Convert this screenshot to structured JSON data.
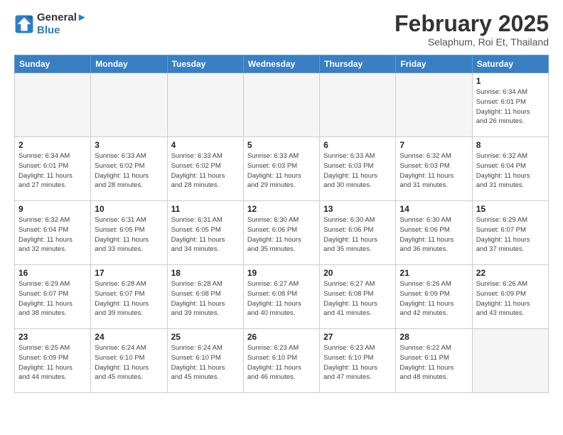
{
  "header": {
    "logo_line1": "General",
    "logo_line2": "Blue",
    "month": "February 2025",
    "location": "Selaphum, Roi Et, Thailand"
  },
  "weekdays": [
    "Sunday",
    "Monday",
    "Tuesday",
    "Wednesday",
    "Thursday",
    "Friday",
    "Saturday"
  ],
  "weeks": [
    [
      {
        "day": "",
        "info": ""
      },
      {
        "day": "",
        "info": ""
      },
      {
        "day": "",
        "info": ""
      },
      {
        "day": "",
        "info": ""
      },
      {
        "day": "",
        "info": ""
      },
      {
        "day": "",
        "info": ""
      },
      {
        "day": "1",
        "info": "Sunrise: 6:34 AM\nSunset: 6:01 PM\nDaylight: 11 hours\nand 26 minutes."
      }
    ],
    [
      {
        "day": "2",
        "info": "Sunrise: 6:34 AM\nSunset: 6:01 PM\nDaylight: 11 hours\nand 27 minutes."
      },
      {
        "day": "3",
        "info": "Sunrise: 6:33 AM\nSunset: 6:02 PM\nDaylight: 11 hours\nand 28 minutes."
      },
      {
        "day": "4",
        "info": "Sunrise: 6:33 AM\nSunset: 6:02 PM\nDaylight: 11 hours\nand 28 minutes."
      },
      {
        "day": "5",
        "info": "Sunrise: 6:33 AM\nSunset: 6:03 PM\nDaylight: 11 hours\nand 29 minutes."
      },
      {
        "day": "6",
        "info": "Sunrise: 6:33 AM\nSunset: 6:03 PM\nDaylight: 11 hours\nand 30 minutes."
      },
      {
        "day": "7",
        "info": "Sunrise: 6:32 AM\nSunset: 6:03 PM\nDaylight: 11 hours\nand 31 minutes."
      },
      {
        "day": "8",
        "info": "Sunrise: 6:32 AM\nSunset: 6:04 PM\nDaylight: 11 hours\nand 31 minutes."
      }
    ],
    [
      {
        "day": "9",
        "info": "Sunrise: 6:32 AM\nSunset: 6:04 PM\nDaylight: 11 hours\nand 32 minutes."
      },
      {
        "day": "10",
        "info": "Sunrise: 6:31 AM\nSunset: 6:05 PM\nDaylight: 11 hours\nand 33 minutes."
      },
      {
        "day": "11",
        "info": "Sunrise: 6:31 AM\nSunset: 6:05 PM\nDaylight: 11 hours\nand 34 minutes."
      },
      {
        "day": "12",
        "info": "Sunrise: 6:30 AM\nSunset: 6:06 PM\nDaylight: 11 hours\nand 35 minutes."
      },
      {
        "day": "13",
        "info": "Sunrise: 6:30 AM\nSunset: 6:06 PM\nDaylight: 11 hours\nand 35 minutes."
      },
      {
        "day": "14",
        "info": "Sunrise: 6:30 AM\nSunset: 6:06 PM\nDaylight: 11 hours\nand 36 minutes."
      },
      {
        "day": "15",
        "info": "Sunrise: 6:29 AM\nSunset: 6:07 PM\nDaylight: 11 hours\nand 37 minutes."
      }
    ],
    [
      {
        "day": "16",
        "info": "Sunrise: 6:29 AM\nSunset: 6:07 PM\nDaylight: 11 hours\nand 38 minutes."
      },
      {
        "day": "17",
        "info": "Sunrise: 6:28 AM\nSunset: 6:07 PM\nDaylight: 11 hours\nand 39 minutes."
      },
      {
        "day": "18",
        "info": "Sunrise: 6:28 AM\nSunset: 6:08 PM\nDaylight: 11 hours\nand 39 minutes."
      },
      {
        "day": "19",
        "info": "Sunrise: 6:27 AM\nSunset: 6:08 PM\nDaylight: 11 hours\nand 40 minutes."
      },
      {
        "day": "20",
        "info": "Sunrise: 6:27 AM\nSunset: 6:08 PM\nDaylight: 11 hours\nand 41 minutes."
      },
      {
        "day": "21",
        "info": "Sunrise: 6:26 AM\nSunset: 6:09 PM\nDaylight: 11 hours\nand 42 minutes."
      },
      {
        "day": "22",
        "info": "Sunrise: 6:26 AM\nSunset: 6:09 PM\nDaylight: 11 hours\nand 43 minutes."
      }
    ],
    [
      {
        "day": "23",
        "info": "Sunrise: 6:25 AM\nSunset: 6:09 PM\nDaylight: 11 hours\nand 44 minutes."
      },
      {
        "day": "24",
        "info": "Sunrise: 6:24 AM\nSunset: 6:10 PM\nDaylight: 11 hours\nand 45 minutes."
      },
      {
        "day": "25",
        "info": "Sunrise: 6:24 AM\nSunset: 6:10 PM\nDaylight: 11 hours\nand 45 minutes."
      },
      {
        "day": "26",
        "info": "Sunrise: 6:23 AM\nSunset: 6:10 PM\nDaylight: 11 hours\nand 46 minutes."
      },
      {
        "day": "27",
        "info": "Sunrise: 6:23 AM\nSunset: 6:10 PM\nDaylight: 11 hours\nand 47 minutes."
      },
      {
        "day": "28",
        "info": "Sunrise: 6:22 AM\nSunset: 6:11 PM\nDaylight: 11 hours\nand 48 minutes."
      },
      {
        "day": "",
        "info": ""
      }
    ]
  ]
}
